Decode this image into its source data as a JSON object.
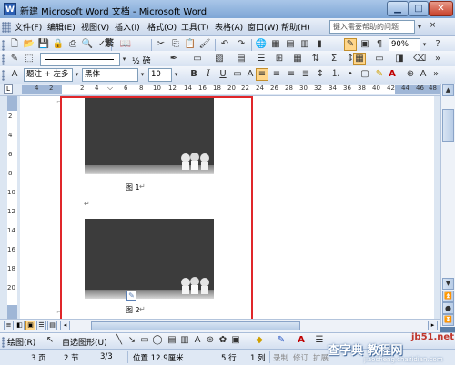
{
  "window": {
    "title": "新建 Microsoft Word 文档 - Microsoft Word",
    "app_icon": "W"
  },
  "menu": {
    "items": [
      "文件(F)",
      "编辑(E)",
      "视图(V)",
      "插入(I)",
      "格式(O)",
      "工具(T)",
      "表格(A)",
      "窗口(W)",
      "帮助(H)"
    ],
    "help_placeholder": "键入需要帮助的问题"
  },
  "standard_toolbar": {
    "traditional_label": "繁",
    "zoom": "90%"
  },
  "drawing_toolbar_top": {
    "line_weight": "½ 磅"
  },
  "formatting_toolbar": {
    "style": "题注 + 左多",
    "font": "黑体",
    "font_size": "10",
    "bold": "B",
    "italic": "I",
    "underline": "U",
    "font_color_letter": "A"
  },
  "ruler": {
    "numbers": [
      "4",
      "2",
      "2",
      "4",
      "6",
      "8",
      "10",
      "12",
      "14",
      "16",
      "18",
      "20",
      "22",
      "24",
      "26",
      "28",
      "30",
      "32",
      "34",
      "36",
      "38",
      "40",
      "42",
      "44",
      "46",
      "48"
    ],
    "vertical_numbers": [
      "2",
      "4",
      "6",
      "8",
      "10",
      "12",
      "14",
      "16",
      "18",
      "20"
    ]
  },
  "document": {
    "caption1": "图 1",
    "caption2": "图 2",
    "return_mark": "↵"
  },
  "drawing_toolbar": {
    "draw_label": "绘图(R)",
    "autoshapes_label": "自选图形(U)"
  },
  "status": {
    "page": "3 页",
    "section": "2 节",
    "page_of": "3/3",
    "position": "位置 12.9厘米",
    "line": "5 行",
    "column": "1 列",
    "rec": "录制",
    "trk": "修订",
    "ext": "扩展"
  },
  "watermark": {
    "site": "jb51.net",
    "big": "查字典 教程网",
    "url": "jiaocheng.chazidian.com"
  },
  "colors": {
    "accent_highlight": "#ffd68a",
    "frame_red": "#e0262a",
    "titlebar": "#7ea6d6"
  }
}
